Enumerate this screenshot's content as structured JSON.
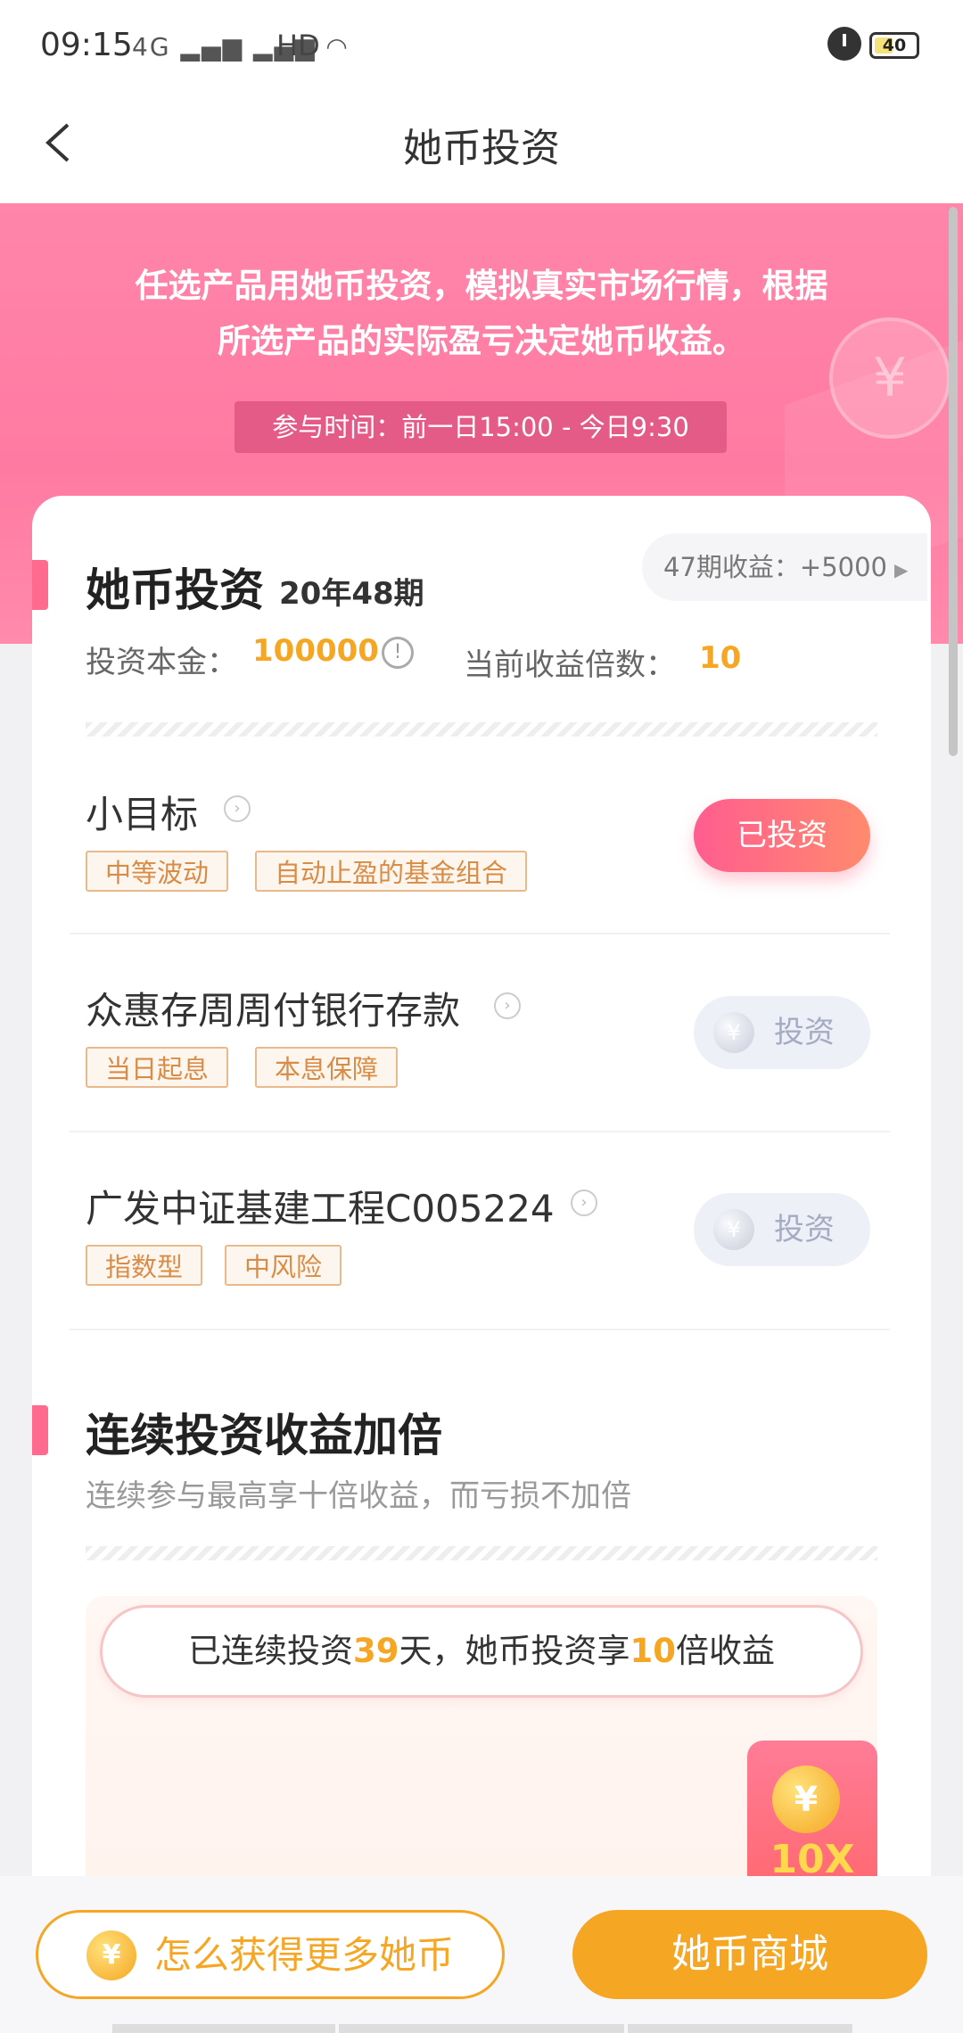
{
  "status": {
    "time": "09:15",
    "signal": "4G",
    "hd": "HD",
    "battery": "40"
  },
  "header": {
    "title": "她币投资"
  },
  "banner": {
    "line1": "任选产品用她币投资，模拟真实市场行情，根据",
    "line2": "所选产品的实际盈亏决定她币收益。",
    "time_label": "参与时间：前一日15:00 - 今日9:30",
    "coin_symbol": "¥"
  },
  "invest": {
    "title": "她币投资",
    "period": "20年48期",
    "prev_label": "47期收益：+5000",
    "principal_label": "投资本金：",
    "principal_value": "100000",
    "multiplier_label": "当前收益倍数：",
    "multiplier_value": "10"
  },
  "products": [
    {
      "name": "小目标",
      "tags": [
        "中等波动",
        "自动止盈的基金组合"
      ],
      "button": "已投资"
    },
    {
      "name": "众惠存周周付银行存款",
      "tags": [
        "当日起息",
        "本息保障"
      ],
      "button": "投资"
    },
    {
      "name": "广发中证基建工程C005224",
      "tags": [
        "指数型",
        "中风险"
      ],
      "button": "投资"
    }
  ],
  "streak": {
    "title": "连续投资收益加倍",
    "subtitle": "连续参与最高享十倍收益，而亏损不加倍",
    "pill_prefix": "已连续投资",
    "days": "39",
    "pill_mid": "天，她币投资享",
    "mult": "10",
    "pill_suffix": "倍收益",
    "card_label": "10X"
  },
  "bottom": {
    "earn_label": "怎么获得更多她币",
    "shop_label": "她币商城",
    "coin_symbol": "¥"
  },
  "colors": {
    "accent_pink": "#ff7aa2",
    "accent_orange": "#f5a623"
  }
}
